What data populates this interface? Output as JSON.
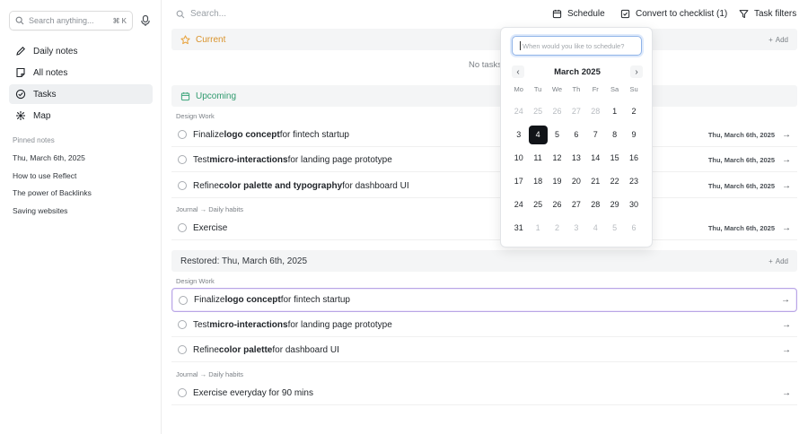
{
  "sidebar": {
    "search_placeholder": "Search anything...",
    "search_shortcut": "⌘ K",
    "nav": [
      {
        "label": "Daily notes",
        "icon": "pencil-icon"
      },
      {
        "label": "All notes",
        "icon": "note-icon"
      },
      {
        "label": "Tasks",
        "icon": "check-circle-icon",
        "active": true
      },
      {
        "label": "Map",
        "icon": "graph-map-icon"
      }
    ],
    "pinned_title": "Pinned notes",
    "pinned": [
      "Thu, March 6th, 2025",
      "How to use Reflect",
      "The power of Backlinks",
      "Saving websites"
    ]
  },
  "topbar": {
    "search_placeholder": "Search...",
    "schedule": "Schedule",
    "convert": "Convert to checklist (1)",
    "filters": "Task filters"
  },
  "sections": {
    "current": {
      "title": "Current",
      "add": "Add",
      "empty": "No tasks"
    },
    "upcoming": {
      "title": "Upcoming"
    },
    "restored": {
      "title": "Restored: Thu, March 6th, 2025",
      "add": "Add"
    }
  },
  "upcoming": {
    "crumb1": "Design Work",
    "crumb2": "Journal → Daily habits",
    "tasks": [
      {
        "pre": "Finalize ",
        "bold": "logo concept",
        "post": " for fintech startup",
        "date": "Thu, March 6th, 2025"
      },
      {
        "pre": "Test ",
        "bold": "micro-interactions",
        "post": " for landing page prototype",
        "date": "Thu, March 6th, 2025"
      },
      {
        "pre": "Refine ",
        "bold": "color palette and typography",
        "post": " for dashboard UI",
        "date": "Thu, March 6th, 2025"
      },
      {
        "pre": "Exercise",
        "bold": "",
        "post": "",
        "date": "Thu, March 6th, 2025"
      }
    ]
  },
  "restored": {
    "crumb1": "Design Work",
    "crumb2": "Journal → Daily habits",
    "tasks": [
      {
        "pre": "Finalize ",
        "bold": "logo concept",
        "post": " for fintech startup"
      },
      {
        "pre": "Test ",
        "bold": "micro-interactions",
        "post": " for landing page prototype"
      },
      {
        "pre": "Refine ",
        "bold": "color palette",
        "post": " for dashboard UI"
      },
      {
        "pre": "Exercise everyday for 90 mins",
        "bold": "",
        "post": ""
      }
    ]
  },
  "scheduler": {
    "placeholder": "When would you like to schedule?",
    "month": "March 2025",
    "dow": [
      "Mo",
      "Tu",
      "We",
      "Th",
      "Fr",
      "Sa",
      "Su"
    ],
    "weeks": [
      [
        "24",
        "25",
        "26",
        "27",
        "28",
        "1",
        "2"
      ],
      [
        "3",
        "4",
        "5",
        "6",
        "7",
        "8",
        "9"
      ],
      [
        "10",
        "11",
        "12",
        "13",
        "14",
        "15",
        "16"
      ],
      [
        "17",
        "18",
        "19",
        "20",
        "21",
        "22",
        "23"
      ],
      [
        "24",
        "25",
        "26",
        "27",
        "28",
        "29",
        "30"
      ],
      [
        "31",
        "1",
        "2",
        "3",
        "4",
        "5",
        "6"
      ]
    ],
    "selected": "4"
  },
  "colors": {
    "accent_current": "#e8a33d",
    "accent_upcoming": "#3aa57a",
    "highlight": "#b9a6e6",
    "selected_day": "#111418"
  }
}
